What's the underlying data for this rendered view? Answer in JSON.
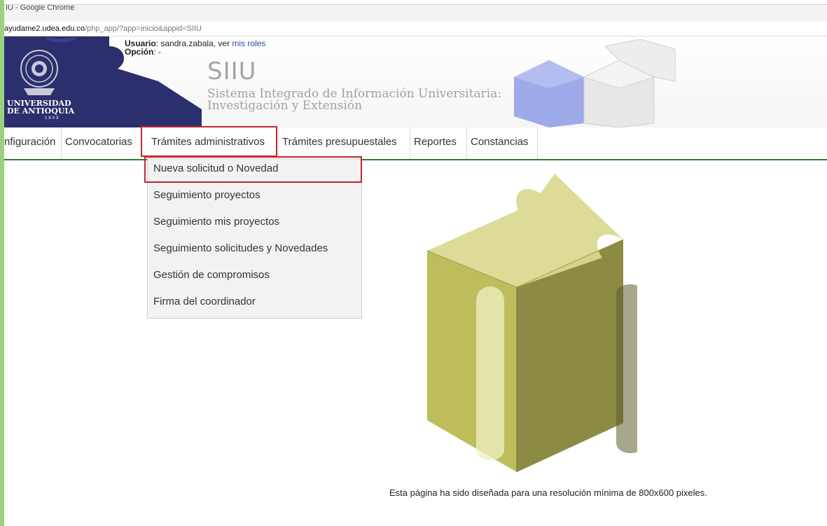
{
  "window": {
    "title": "IU - Google Chrome"
  },
  "url": {
    "host": "ayudame2.udea.edu.co",
    "path": "/php_app/?app=inicio&appid=SIIU"
  },
  "header": {
    "user_label": "Usuario",
    "user_value": ": sandra.zabala, ver ",
    "roles_link": "mis roles",
    "option_label": "Opción",
    "option_value": ": -",
    "university_line1": "UNIVERSIDAD",
    "university_line2": "DE ANTIOQUIA",
    "university_year": "1803",
    "system_title": "SIIU",
    "system_sub1": "Sistema Integrado de Información Universitaria:",
    "system_sub2": "Investigación y Extensión"
  },
  "menu": {
    "items": [
      {
        "label": "nfiguración"
      },
      {
        "label": "Convocatorias"
      },
      {
        "label": "Trámites administrativos"
      },
      {
        "label": "Trámites presupuestales"
      },
      {
        "label": "Reportes"
      },
      {
        "label": "Constancias"
      }
    ]
  },
  "dropdown": {
    "items": [
      {
        "label": "Nueva solicitud o Novedad"
      },
      {
        "label": "Seguimiento proyectos"
      },
      {
        "label": "Seguimiento mis proyectos"
      },
      {
        "label": "Seguimiento solicitudes y Novedades"
      },
      {
        "label": "Gestión de compromisos"
      },
      {
        "label": "Firma del coordinador"
      }
    ]
  },
  "footer": {
    "note": "Esta página ha sido diseñada para una resolución mínima de 800x600 pixeles."
  },
  "colors": {
    "navy": "#2b2f6e",
    "highlight": "#c1272d",
    "menu_underline": "#2e7d32",
    "puzzle": "#d4d48a"
  }
}
